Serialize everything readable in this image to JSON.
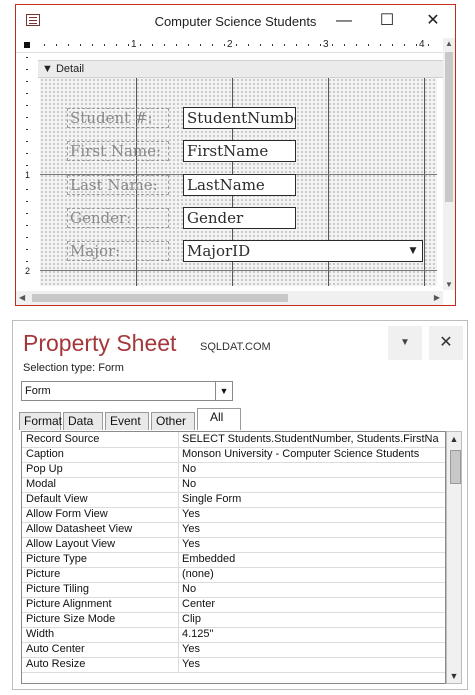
{
  "form_window": {
    "title": "Computer Science Students",
    "minimize_glyph": "—",
    "maximize_glyph": "☐",
    "close_glyph": "✕",
    "ruler_numbers": [
      "1",
      "2",
      "3",
      "4"
    ],
    "vruler_numbers": [
      "1",
      "2"
    ],
    "section_label": "Detail",
    "fields": [
      {
        "label": "Student #:",
        "control": "StudentNumber",
        "type": "textbox"
      },
      {
        "label": "First Name:",
        "control": "FirstName",
        "type": "textbox"
      },
      {
        "label": "Last Name:",
        "control": "LastName",
        "type": "textbox"
      },
      {
        "label": "Gender:",
        "control": "Gender",
        "type": "textbox"
      },
      {
        "label": "Major:",
        "control": "MajorID",
        "type": "combobox"
      }
    ]
  },
  "property_sheet": {
    "title": "Property Sheet",
    "watermark": "SQLDAT.COM",
    "selection_type_label": "Selection type:",
    "selection_type_value": "Form",
    "object_selected": "Form",
    "tabs": [
      "Format",
      "Data",
      "Event",
      "Other",
      "All"
    ],
    "active_tab": "All",
    "properties": [
      {
        "name": "Record Source",
        "value": "SELECT Students.StudentNumber, Students.FirstNa"
      },
      {
        "name": "Caption",
        "value": "Monson University - Computer Science Students"
      },
      {
        "name": "Pop Up",
        "value": "No"
      },
      {
        "name": "Modal",
        "value": "No"
      },
      {
        "name": "Default View",
        "value": "Single Form"
      },
      {
        "name": "Allow Form View",
        "value": "Yes"
      },
      {
        "name": "Allow Datasheet View",
        "value": "Yes"
      },
      {
        "name": "Allow Layout View",
        "value": "Yes"
      },
      {
        "name": "Picture Type",
        "value": "Embedded"
      },
      {
        "name": "Picture",
        "value": "(none)"
      },
      {
        "name": "Picture Tiling",
        "value": "No"
      },
      {
        "name": "Picture Alignment",
        "value": "Center"
      },
      {
        "name": "Picture Size Mode",
        "value": "Clip"
      },
      {
        "name": "Width",
        "value": "4.125\""
      },
      {
        "name": "Auto Center",
        "value": "Yes"
      },
      {
        "name": "Auto Resize",
        "value": "Yes"
      }
    ]
  }
}
